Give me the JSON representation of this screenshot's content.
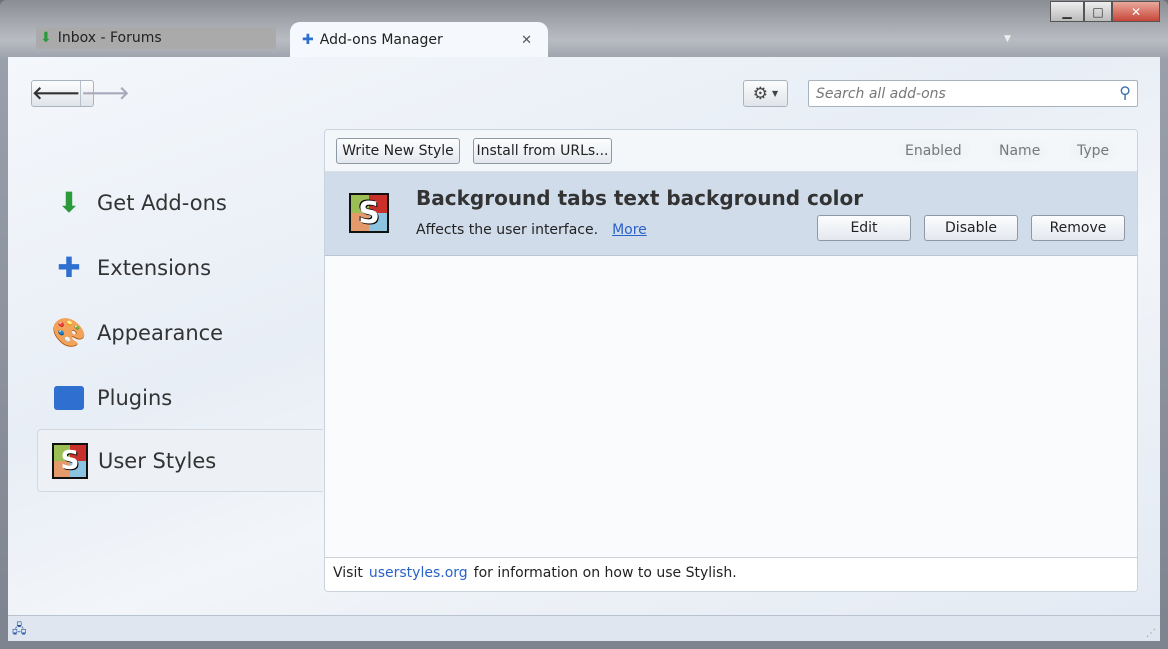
{
  "tabs": [
    {
      "label": "Inbox - Forums",
      "icon": "inbox-download-icon"
    },
    {
      "label": "Add-ons Manager",
      "icon": "puzzle-icon"
    }
  ],
  "window_controls": {
    "minimize": "▁",
    "maximize": "□",
    "close": "✕"
  },
  "search": {
    "placeholder": "Search all add-ons",
    "value": ""
  },
  "sidebar": {
    "items": [
      {
        "label": "Get Add-ons"
      },
      {
        "label": "Extensions"
      },
      {
        "label": "Appearance"
      },
      {
        "label": "Plugins"
      },
      {
        "label": "User Styles",
        "selected": true
      }
    ]
  },
  "toolbar": {
    "write_new_style": "Write New Style",
    "install_from_urls": "Install from URLs...",
    "sort": [
      "Enabled",
      "Name",
      "Type"
    ]
  },
  "addon": {
    "title": "Background tabs text background color",
    "description": "Affects the user interface.",
    "more": "More",
    "edit": "Edit",
    "disable": "Disable",
    "remove": "Remove"
  },
  "footer": {
    "before": "Visit",
    "link": "userstyles.org",
    "after": "for information on how to use Stylish."
  },
  "colors": {
    "accent": "#2a62c9",
    "row_bg": "#d0dcea"
  }
}
